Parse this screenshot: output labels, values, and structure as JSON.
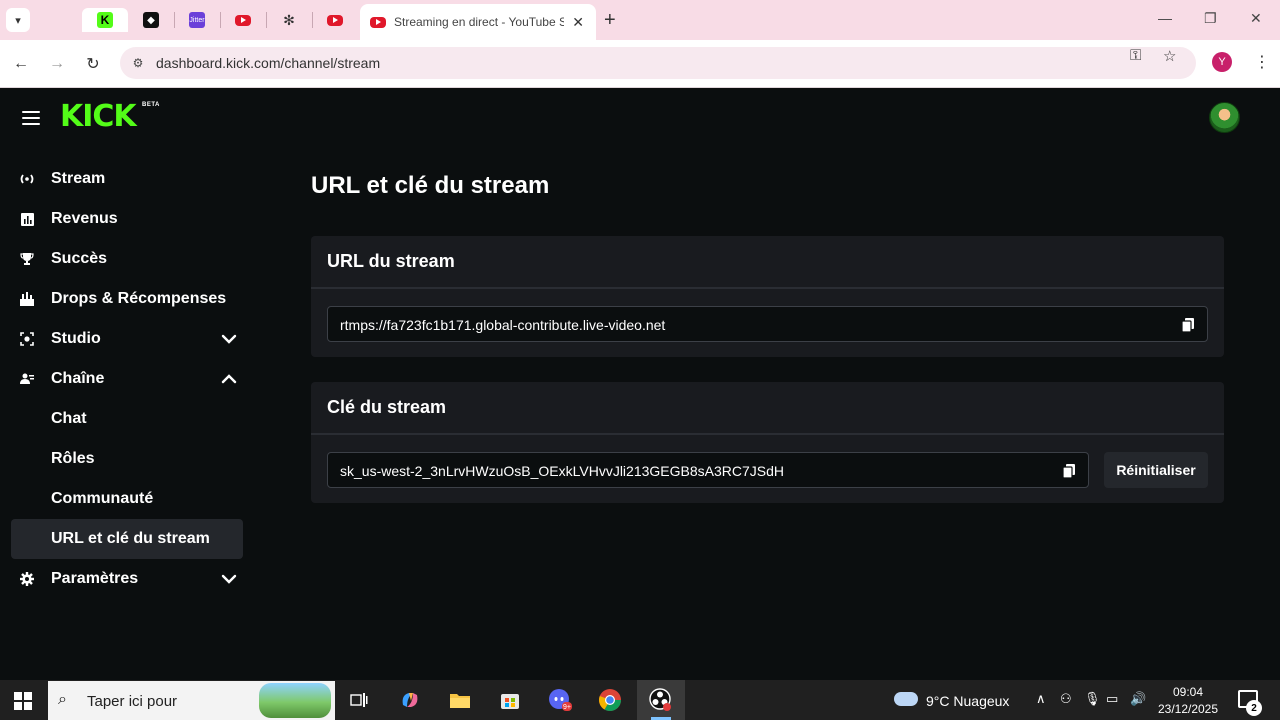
{
  "browser": {
    "active_tab_title": "Streaming en direct - YouTube Studio",
    "url": "dashboard.kick.com/channel/stream",
    "profile_initial": "Y",
    "favicon_labels": {
      "kick": "K",
      "jitter": "Jitter"
    },
    "icons": [
      "tab-list-icon",
      "microsoft-icon",
      "kick-icon",
      "gem-icon",
      "jitter-icon",
      "youtube-icon",
      "ai-icon",
      "new-tab-icon",
      "back-icon",
      "forward-icon",
      "reload-icon",
      "site-info-icon",
      "password-key-icon",
      "bookmark-star-icon",
      "menu-dots-icon"
    ]
  },
  "app": {
    "logo": "KICK",
    "beta": "BETA"
  },
  "sidebar": {
    "items": [
      {
        "label": "Stream",
        "icon": "broadcast-icon"
      },
      {
        "label": "Revenus",
        "icon": "chart-icon"
      },
      {
        "label": "Succès",
        "icon": "trophy-icon"
      },
      {
        "label": "Drops & Récompenses",
        "icon": "drops-icon"
      },
      {
        "label": "Studio",
        "icon": "studio-icon",
        "chevron": "down"
      },
      {
        "label": "Chaîne",
        "icon": "channel-icon",
        "chevron": "up"
      },
      {
        "label": "Chat"
      },
      {
        "label": "Rôles"
      },
      {
        "label": "Communauté"
      },
      {
        "label": "URL et clé du stream",
        "active": true
      },
      {
        "label": "Paramètres",
        "icon": "gear-icon",
        "chevron": "down"
      }
    ]
  },
  "main": {
    "title": "URL et clé du stream",
    "url_card": {
      "heading": "URL du stream",
      "value": "rtmps://fa723fc1b171.global-contribute.live-video.net"
    },
    "key_card": {
      "heading": "Clé du stream",
      "value": "sk_us-west-2_3nLrvHWzuOsB_OExkLVHvvJli213GEGB8sA3RC7JSdH",
      "reset_label": "Réinitialiser"
    }
  },
  "taskbar": {
    "search_placeholder": "Taper ici pour",
    "weather": "9°C  Nuageux",
    "time": "09:04",
    "date": "23/12/2025",
    "notification_count": "2",
    "discord_badge": "9+"
  },
  "colors": {
    "brand": "#53fc18",
    "background": "#0b0e0f",
    "card": "#191b1f",
    "active_item": "#24272c",
    "browser_tabbar": "#f8dce6"
  }
}
